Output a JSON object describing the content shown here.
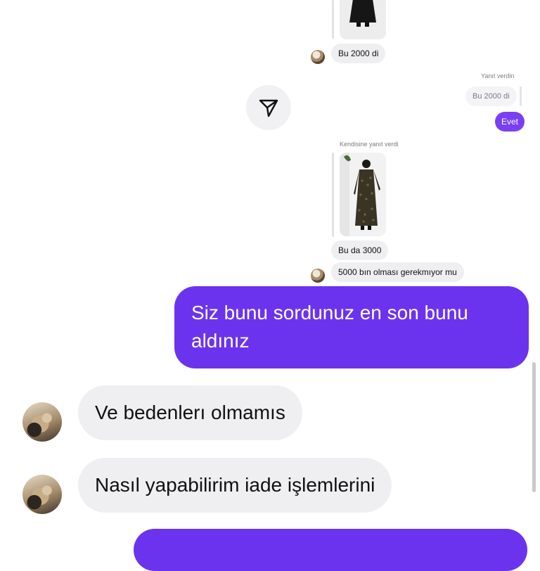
{
  "messages": {
    "msg1_text": "Bu 2000 di",
    "reply_label_1": "Yanıt verdin",
    "quoted_text": "Bu 2000 di",
    "evet_text": "Evet",
    "reply_label_2": "Kendisine yanıt verdi",
    "msg_bu_da": "Bu da 3000",
    "msg_5000": "5000 bın olması gerekmıyor mu",
    "msg_siz_bunu": "Siz bunu sordunuz en son bunu aldınız",
    "msg_bedenler": "Ve bedenlerı olmamıs",
    "msg_iade": "Nasıl yapabilirim iade işlemlerini"
  },
  "icons": {
    "share": "paper-plane-icon"
  },
  "colors": {
    "accent_purple": "#6c33ee",
    "bubble_gray": "#efeff2",
    "meta_text": "#7b7b82"
  }
}
